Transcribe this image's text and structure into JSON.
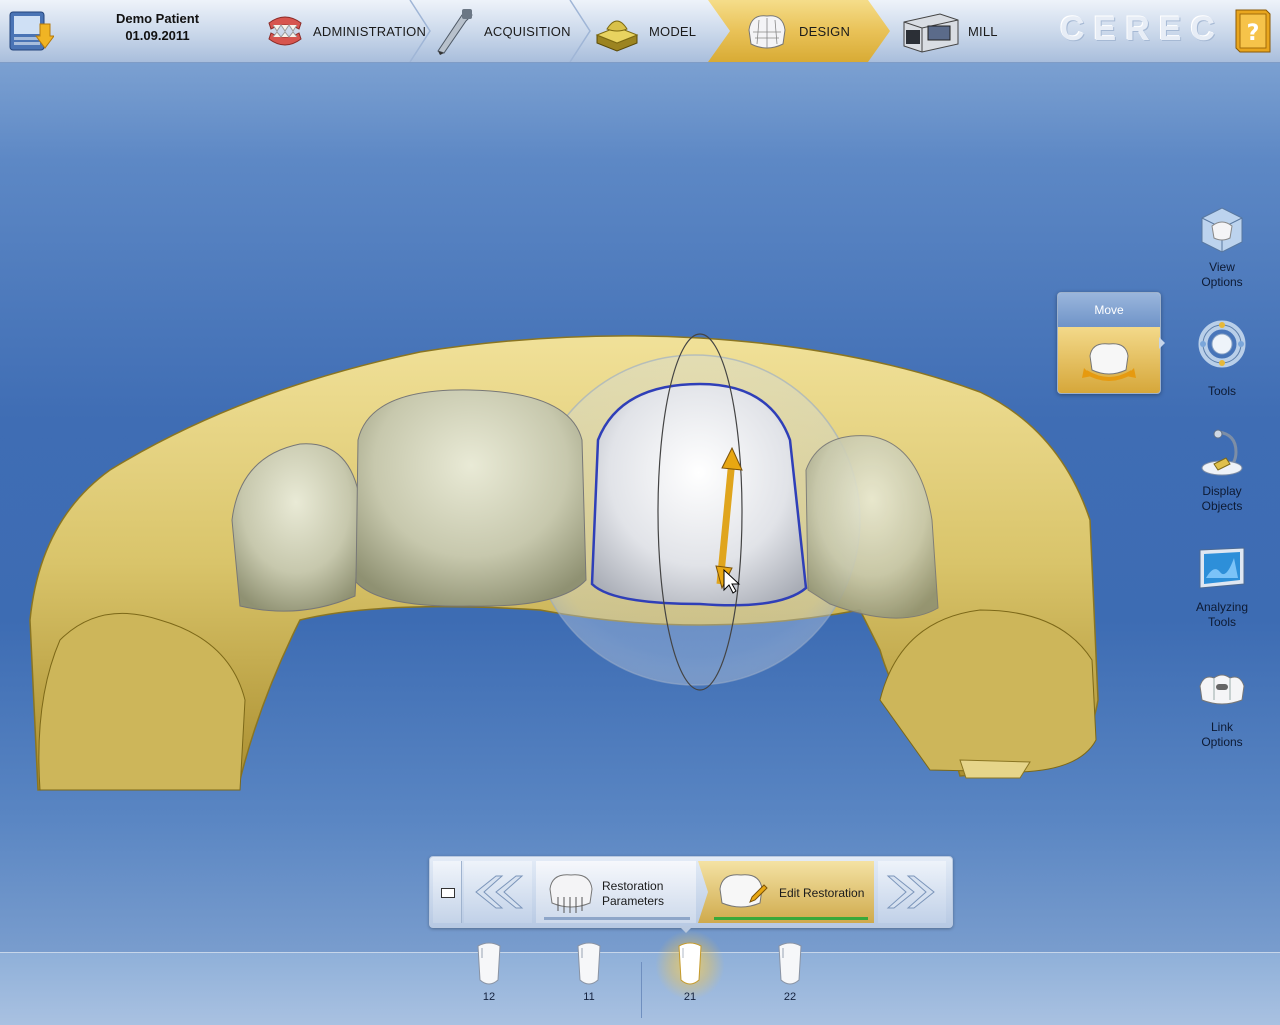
{
  "header": {
    "patient_name": "Demo Patient",
    "patient_date": "01.09.2011",
    "brand": "CEREC",
    "steps": [
      {
        "label": "ADMINISTRATION",
        "icon": "denture-icon",
        "active": false
      },
      {
        "label": "ACQUISITION",
        "icon": "camera-wand-icon",
        "active": false
      },
      {
        "label": "MODEL",
        "icon": "model-block-icon",
        "active": false
      },
      {
        "label": "DESIGN",
        "icon": "crown-design-icon",
        "active": true
      },
      {
        "label": "MILL",
        "icon": "milling-machine-icon",
        "active": false
      }
    ]
  },
  "sidebar": {
    "items": [
      {
        "label": "View\nOptions",
        "icon": "view-cube-icon"
      },
      {
        "label": "Tools",
        "icon": "tools-ring-icon"
      },
      {
        "label": "Display\nObjects",
        "icon": "display-objects-icon"
      },
      {
        "label": "Analyzing\nTools",
        "icon": "analyzing-monitor-icon"
      },
      {
        "label": "Link\nOptions",
        "icon": "link-teeth-icon"
      }
    ],
    "popup": {
      "title": "Move",
      "icon": "move-tooth-icon"
    }
  },
  "stepbar": {
    "param_label_1": "Restoration",
    "param_label_2": "Parameters",
    "edit_label": "Edit Restoration",
    "colors": {
      "progress": "#3aa83a",
      "active": "#e2bf5a"
    }
  },
  "teeth": [
    {
      "number": "12",
      "selected": false
    },
    {
      "number": "11",
      "selected": false
    },
    {
      "number": "21",
      "selected": true
    },
    {
      "number": "22",
      "selected": false
    }
  ],
  "colors": {
    "accent": "#e9c258",
    "model": "#d9c46a",
    "bg": "#3f6db4"
  }
}
